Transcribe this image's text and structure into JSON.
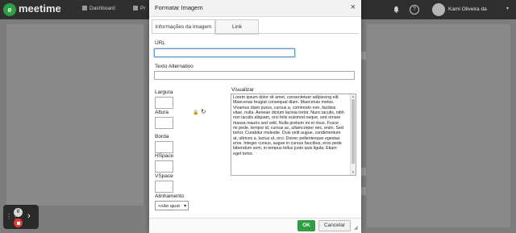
{
  "nav": {
    "brand": "meetime",
    "logo_text": "e",
    "items": [
      {
        "label": "Dashboard"
      },
      {
        "label": "Pr"
      }
    ],
    "user_name": "Kami Oliveira da",
    "help_glyph": "?"
  },
  "dialog": {
    "title": "Formatar Imagem",
    "close_glyph": "×",
    "tabs": [
      {
        "label": "Informações da Imagem",
        "active": true
      },
      {
        "label": "Link",
        "active": false
      }
    ],
    "url_label": "URL",
    "url_value": "",
    "alt_label": "Texto Alternativo",
    "alt_value": "",
    "width_label": "Largura",
    "height_label": "Altura",
    "border_label": "Borda",
    "hspace_label": "HSpace",
    "vspace_label": "VSpace",
    "align_label": "Alinhamento",
    "align_value": "<não ajust",
    "preview_label": "Visualizar",
    "preview_text": "Lorem ipsum dolor sit amet, consectetuer adipiscing elit. Maecenas feugiat consequat diam. Maecenas metus. Vivamus diam purus, cursus a, commodo non, facilisis vitae, nulla. Aenean dictum lacinia tortor. Nunc iaculis, nibh non iaculis aliquam, orci felis euismod neque, sed ornare massa mauris sed velit. Nulla pretium mi et risus. Fusce mi pede, tempor id, cursus ac, ullamcorper nec, enim. Sed tortor. Curabitur molestie. Duis velit augue, condimentum at, ultrices a, luctus ut, orci. Donec pellentesque egestas eros. Integer cursus, augue in cursus faucibus, eros pede bibendum sem, in tempus tellus justo quis ligula. Etiam eget tortor.",
    "ok_label": "OK",
    "cancel_label": "Cancelar"
  },
  "recorder": {
    "pause_glyph": "II",
    "arrow_glyph": "›"
  },
  "colors": {
    "accent_green": "#2ea043",
    "stop_red": "#e53935"
  }
}
